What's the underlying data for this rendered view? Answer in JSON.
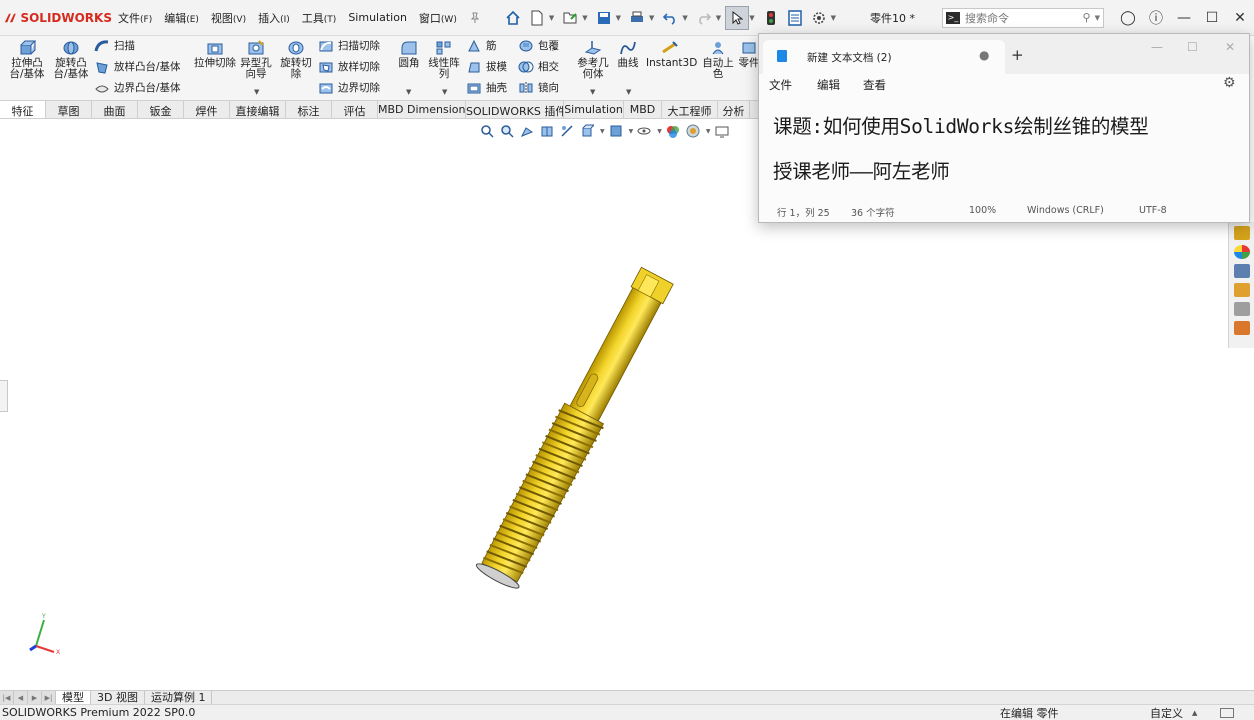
{
  "app": {
    "brand_prefix": "3DS",
    "brand": "SOLIDWORKS"
  },
  "menu": [
    {
      "label": "文件",
      "accel": "(F)"
    },
    {
      "label": "编辑",
      "accel": "(E)"
    },
    {
      "label": "视图",
      "accel": "(V)"
    },
    {
      "label": "插入",
      "accel": "(I)"
    },
    {
      "label": "工具",
      "accel": "(T)"
    },
    {
      "label": "Simulation",
      "accel": ""
    },
    {
      "label": "窗口",
      "accel": "(W)"
    }
  ],
  "document_title": "零件10 *",
  "search": {
    "placeholder": "搜索命令"
  },
  "commands": {
    "extrude_boss": "拉伸凸台/基体",
    "revolve_boss": "旋转凸台/基体",
    "sweep": "扫描",
    "loft_boss": "放样凸台/基体",
    "boundary_boss": "边界凸台/基体",
    "extrude_cut": "拉伸切除",
    "hole_wizard": "异型孔向导",
    "revolve_cut": "旋转切除",
    "sweep_cut": "扫描切除",
    "loft_cut": "放样切除",
    "boundary_cut": "边界切除",
    "fillet": "圆角",
    "linear_pattern": "线性阵列",
    "rib": "筋",
    "draft": "拔模",
    "shell": "抽壳",
    "wrap": "包覆",
    "intersect": "相交",
    "mirror": "镜向",
    "reference_geometry": "参考几何体",
    "curves": "曲线",
    "instant3d": "Instant3D",
    "auto_color": "自动上色",
    "zero": "零件"
  },
  "tabs": [
    "特征",
    "草图",
    "曲面",
    "钣金",
    "焊件",
    "直接编辑",
    "标注",
    "评估",
    "MBD Dimensions",
    "SOLIDWORKS 插件",
    "Simulation",
    "MBD",
    "大工程师",
    "分析"
  ],
  "bottom_tabs": [
    "模型",
    "3D 视图",
    "运动算例 1"
  ],
  "status": {
    "version": "SOLIDWORKS Premium 2022 SP0.0",
    "editing": "在编辑 零件",
    "custom": "自定义"
  },
  "notepad": {
    "tab_title": "新建 文本文档 (2)",
    "menu": [
      "文件",
      "编辑",
      "查看"
    ],
    "lines": [
      "课题:如何使用SolidWorks绘制丝锥的模型",
      "授课老师——阿左老师"
    ],
    "status": {
      "position": "行 1，列 25",
      "chars": "36 个字符",
      "zoom": "100%",
      "eol": "Windows (CRLF)",
      "encoding": "UTF-8"
    }
  },
  "triad_labels": {
    "y": "Y",
    "x": "X"
  },
  "colors": {
    "part_yellow": "#e8c51a",
    "brand_red": "#d52b1e",
    "accent_blue": "#1e88e5"
  }
}
